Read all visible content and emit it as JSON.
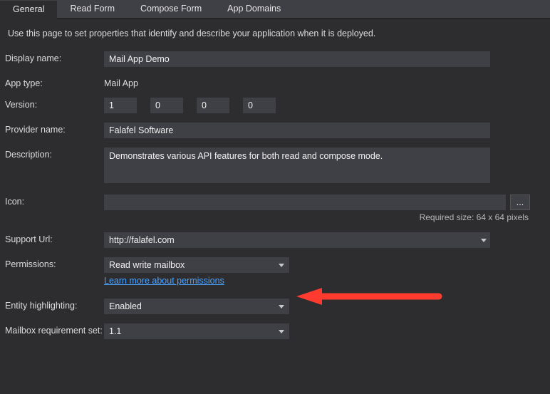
{
  "tabs": {
    "general": "General",
    "readForm": "Read Form",
    "composeForm": "Compose Form",
    "appDomains": "App Domains"
  },
  "intro": "Use this page to set properties that identify and describe your application when it is deployed.",
  "labels": {
    "displayName": "Display name:",
    "appType": "App type:",
    "version": "Version:",
    "providerName": "Provider name:",
    "description": "Description:",
    "icon": "Icon:",
    "supportUrl": "Support Url:",
    "permissions": "Permissions:",
    "entityHighlighting": "Entity highlighting:",
    "mailboxRequirement": "Mailbox requirement set:"
  },
  "values": {
    "displayName": "Mail App Demo",
    "appType": "Mail App",
    "version": [
      "1",
      "0",
      "0",
      "0"
    ],
    "providerName": "Falafel Software",
    "description": "Demonstrates various API features for both read and compose mode.",
    "icon": "",
    "iconHint": "Required size: 64 x 64 pixels",
    "supportUrl": "http://falafel.com",
    "permissions": "Read write mailbox",
    "permissionsLearnMore": "Learn more about permissions",
    "entityHighlighting": "Enabled",
    "mailboxRequirement": "1.1",
    "browseLabel": "..."
  },
  "colors": {
    "arrow": "#ff3b30"
  }
}
